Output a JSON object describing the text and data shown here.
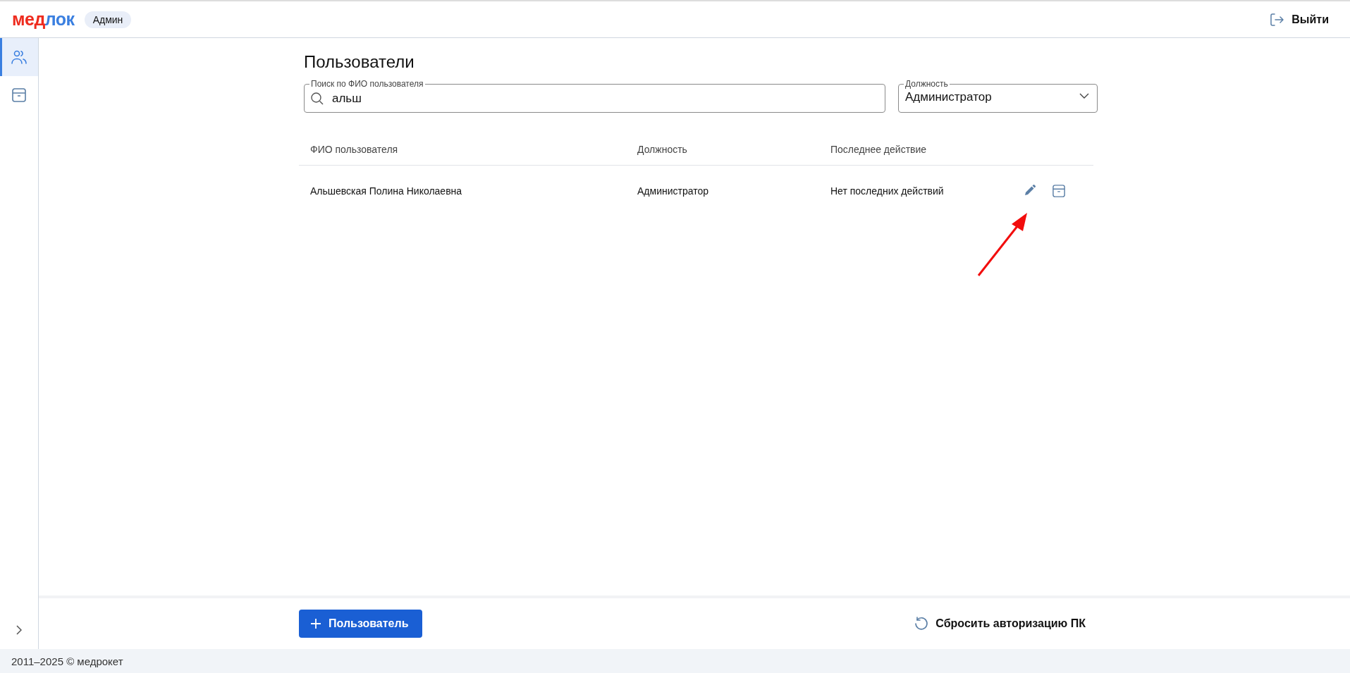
{
  "header": {
    "logo": [
      {
        "text": "мед",
        "color": "#ee2b1e"
      },
      {
        "text": "лок",
        "color": "#3a7fe0"
      }
    ],
    "role_badge": "Админ",
    "logout": "Выйти"
  },
  "sidebar": {
    "items": [
      {
        "kind": "users",
        "selected": true
      },
      {
        "kind": "archive",
        "selected": false
      }
    ]
  },
  "page": {
    "title": "Пользователи",
    "search": {
      "label": "Поиск по ФИО пользователя",
      "value": "альш"
    },
    "position_filter": {
      "label": "Должность",
      "value": "Администратор"
    },
    "table": {
      "columns": [
        "ФИО пользователя",
        "Должность",
        "Последнее действие"
      ],
      "rows": [
        {
          "name": "Альшевская Полина Николаевна",
          "position": "Администратор",
          "last_action": "Нет последних действий"
        }
      ]
    }
  },
  "footer": {
    "add_button": "Пользователь",
    "reset_button": "Сбросить авторизацию ПК"
  },
  "copyright": "2011–2025 © медрокет"
}
